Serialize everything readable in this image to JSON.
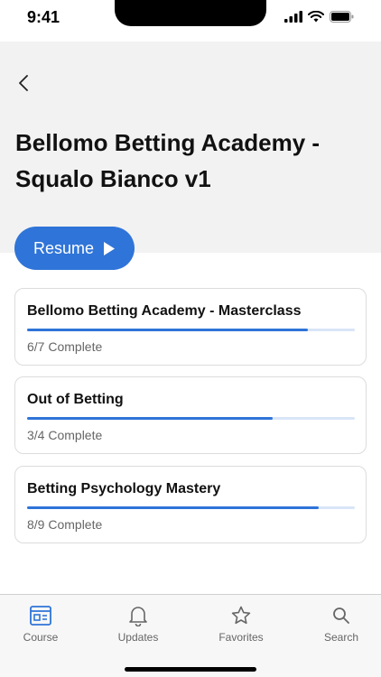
{
  "status_bar": {
    "time": "9:41"
  },
  "header": {
    "title": "Bellomo Betting Academy - Squalo Bianco v1"
  },
  "resume_button": {
    "label": "Resume"
  },
  "courses": [
    {
      "title": "Bellomo Betting Academy - Masterclass",
      "status": "6/7 Complete",
      "progress": 0.857
    },
    {
      "title": "Out of Betting",
      "status": "3/4 Complete",
      "progress": 0.75
    },
    {
      "title": "Betting Psychology Mastery",
      "status": "8/9 Complete",
      "progress": 0.889
    }
  ],
  "tabs": [
    {
      "label": "Course",
      "icon": "course-icon",
      "active": true
    },
    {
      "label": "Updates",
      "icon": "bell-icon",
      "active": false
    },
    {
      "label": "Favorites",
      "icon": "star-icon",
      "active": false
    },
    {
      "label": "Search",
      "icon": "search-icon",
      "active": false
    }
  ],
  "colors": {
    "accent": "#2f74d8",
    "header_bg": "#f2f2f2",
    "tab_bar_bg": "#f7f7f7"
  }
}
